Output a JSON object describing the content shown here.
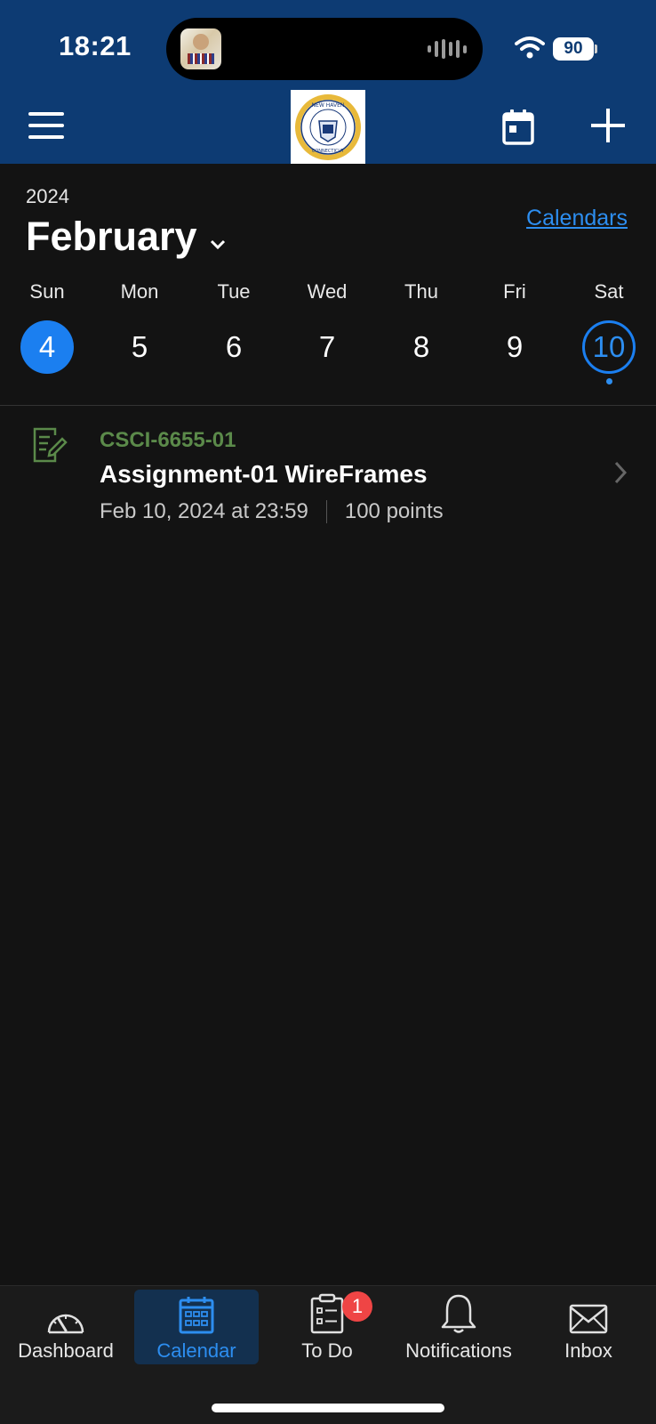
{
  "status_bar": {
    "time": "18:21",
    "battery": "90"
  },
  "header": {
    "logo_alt": "University of New Haven seal"
  },
  "calendar": {
    "year": "2024",
    "month": "February",
    "calendars_link": "Calendars",
    "week": [
      {
        "dow": "Sun",
        "day": "4",
        "state": "selected"
      },
      {
        "dow": "Mon",
        "day": "5",
        "state": ""
      },
      {
        "dow": "Tue",
        "day": "6",
        "state": ""
      },
      {
        "dow": "Wed",
        "day": "7",
        "state": ""
      },
      {
        "dow": "Thu",
        "day": "8",
        "state": ""
      },
      {
        "dow": "Fri",
        "day": "9",
        "state": ""
      },
      {
        "dow": "Sat",
        "day": "10",
        "state": "today"
      }
    ]
  },
  "events": [
    {
      "course": "CSCI-6655-01",
      "title": "Assignment-01 WireFrames",
      "due": "Feb 10, 2024 at 23:59",
      "points": "100 points"
    }
  ],
  "tabbar": {
    "tabs": [
      {
        "label": "Dashboard",
        "icon": "dashboard-icon"
      },
      {
        "label": "Calendar",
        "icon": "calendar-icon",
        "active": true
      },
      {
        "label": "To Do",
        "icon": "todo-icon",
        "badge": "1"
      },
      {
        "label": "Notifications",
        "icon": "bell-icon"
      },
      {
        "label": "Inbox",
        "icon": "mail-icon"
      }
    ]
  },
  "colors": {
    "header_bg": "#0d3b73",
    "accent": "#1b7ff0",
    "course_green": "#5b8a4a",
    "badge_red": "#ef4545",
    "background": "#131313"
  }
}
